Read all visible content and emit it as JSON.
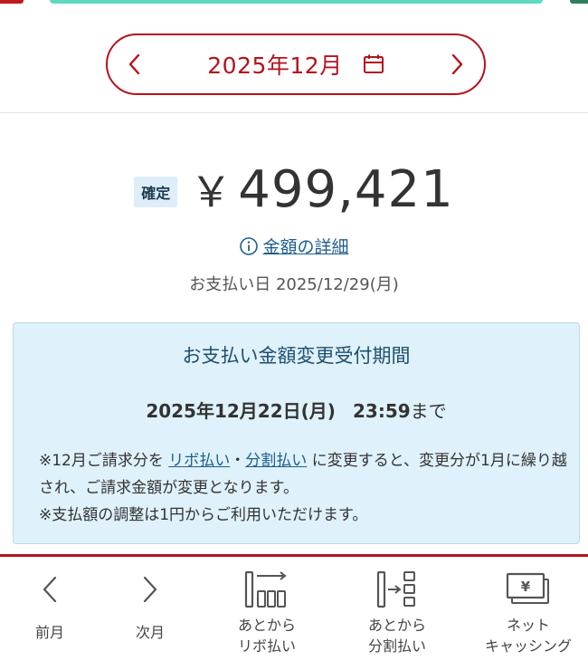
{
  "colors": {
    "brand": "#b5121b",
    "link": "#1e5f8f",
    "info_bg": "#dff1fa"
  },
  "month_selector": {
    "label": "2025年12月",
    "prev_icon": "chevron-left-icon",
    "next_icon": "chevron-right-icon",
    "calendar_icon": "calendar-icon"
  },
  "summary": {
    "status_badge": "確定",
    "currency": "￥",
    "amount": "499,421",
    "detail_link": "金額の詳細",
    "payment_date": "お支払い日 2025/12/29(月)"
  },
  "change_period": {
    "title": "お支払い金額変更受付期間",
    "deadline_date": "2025年12月22日(月)",
    "deadline_time": "23:59",
    "deadline_suffix": "まで",
    "note1_prefix": "※12月ご請求分を",
    "note1_link_ribo": "リボ払い",
    "note1_sep": "・",
    "note1_link_bunkatsu": "分割払い",
    "note1_suffix": "に変更すると、変更分が1月に繰り越され、ご請求金額が変更となります。",
    "note2": "※支払額の調整は1円からご利用いただけます。"
  },
  "bottom_nav": {
    "prev": "前月",
    "next": "次月",
    "ribo_line1": "あとから",
    "ribo_line2": "リボ払い",
    "bunkatsu_line1": "あとから",
    "bunkatsu_line2": "分割払い",
    "cashing_line1": "ネット",
    "cashing_line2": "キャッシング",
    "cashing_icon_glyph": "¥"
  }
}
